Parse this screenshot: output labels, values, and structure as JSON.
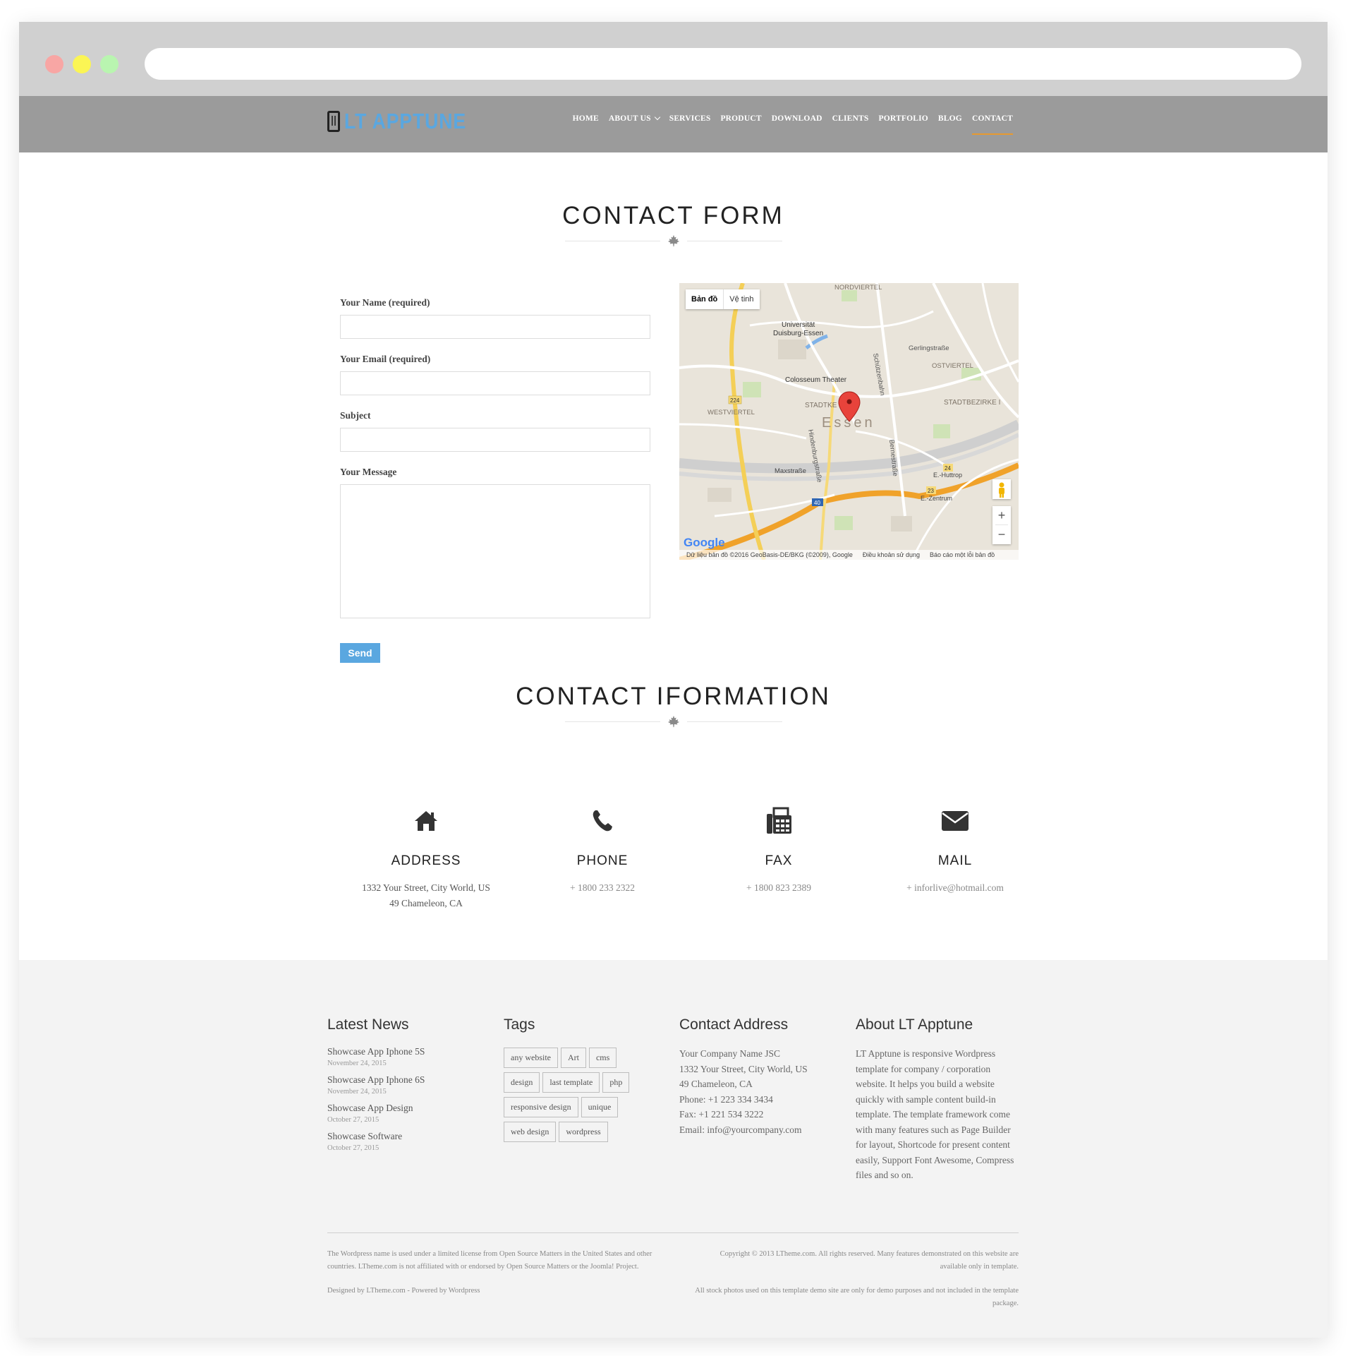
{
  "browser": {
    "url": ""
  },
  "brand": {
    "name": "LT APPTUNE"
  },
  "nav": {
    "items": [
      {
        "label": "HOME"
      },
      {
        "label": "ABOUT US"
      },
      {
        "label": "SERVICES"
      },
      {
        "label": "PRODUCT"
      },
      {
        "label": "DOWNLOAD"
      },
      {
        "label": "CLIENTS"
      },
      {
        "label": "PORTFOLIO"
      },
      {
        "label": "BLOG"
      },
      {
        "label": "CONTACT"
      }
    ],
    "active": "CONTACT"
  },
  "contact_form": {
    "title": "CONTACT FORM",
    "name_label": "Your Name (required)",
    "name_value": "",
    "email_label": "Your Email (required)",
    "email_value": "",
    "subject_label": "Subject",
    "subject_value": "",
    "message_label": "Your Message",
    "message_value": "",
    "send_label": "Send"
  },
  "map": {
    "mode_map": "Bản đồ",
    "mode_satellite": "Vệ tinh",
    "city": "Essen",
    "labels": {
      "nordviertel": "NORDVIERTEL",
      "uni": "Universität",
      "uni2": "Duisburg-Essen",
      "colosseum": "Colosseum Theater",
      "gerling": "Gerlingstraße",
      "ostviertel": "OSTVIERTEL",
      "westviertel": "WESTVIERTEL",
      "stadtkern": "STADTKE",
      "stadtbezirke": "STADTBEZIRKE I",
      "max": "Maxstraße",
      "huttrop": "E.-Huttrop",
      "zentrum": "E.-Zentrum",
      "schuetzen": "Schützenbahn",
      "hindenburg": "Hindenburgstraße",
      "bernestr": "Bernestraße"
    },
    "road_numbers": [
      "224",
      "40",
      "24",
      "23"
    ],
    "zoom_in": "+",
    "zoom_out": "−",
    "google": "Google",
    "attribution": "Dữ liệu bản đồ ©2016 GeoBasis-DE/BKG (©2009), Google",
    "terms": "Điều khoản sử dụng",
    "report": "Báo cáo một lỗi bản đồ"
  },
  "contact_info": {
    "title": "CONTACT IFORMATION",
    "items": [
      {
        "icon": "home-icon",
        "heading": "ADDRESS",
        "line1": "1332 Your Street, City World, US",
        "line2": "49 Chameleon, CA"
      },
      {
        "icon": "phone-icon",
        "heading": "PHONE",
        "line1": "+ 1800 233 2322"
      },
      {
        "icon": "fax-icon",
        "heading": "FAX",
        "line1": "+ 1800 823 2389"
      },
      {
        "icon": "mail-icon",
        "heading": "MAIL",
        "line1": "+ inforlive@hotmail.com"
      }
    ]
  },
  "footer": {
    "news_heading": "Latest News",
    "news": [
      {
        "title": "Showcase App Iphone 5S",
        "date": "November 24, 2015"
      },
      {
        "title": "Showcase App Iphone 6S",
        "date": "November 24, 2015"
      },
      {
        "title": "Showcase App Design",
        "date": "October 27, 2015"
      },
      {
        "title": "Showcase Software",
        "date": "October 27, 2015"
      }
    ],
    "tags_heading": "Tags",
    "tags": [
      "any website",
      "Art",
      "cms",
      "design",
      "last template",
      "php",
      "responsive design",
      "unique",
      "web design",
      "wordpress"
    ],
    "address_heading": "Contact Address",
    "address_lines": [
      "Your Company Name JSC",
      "1332 Your Street, City World, US",
      "49 Chameleon, CA",
      "Phone: +1 223 334 3434",
      "Fax: +1 221 534 3222",
      "Email: info@yourcompany.com"
    ],
    "about_heading": "About LT Apptune",
    "about_text": "LT Apptune is responsive Wordpress template for company / corporation website. It helps you build a website quickly with sample content build-in template. The template framework come with many features such as Page Builder for layout, Shortcode for present content easily, Support Font Awesome, Compress files and so on.",
    "legal_left": "The Wordpress name is used under a limited license from Open Source Matters in the United States and other countries. LTheme.com is not affiliated with or endorsed by Open Source Matters or the Joomla! Project.",
    "credit": "Designed by LTheme.com - Powered by Wordpress",
    "copyright": "Copyright © 2013 LTheme.com. All rights reserved. Many features demonstrated on this website are available only in template.",
    "stock_note": "All stock photos used on this template demo site are only for demo purposes and not included in the template package."
  },
  "colors": {
    "accent": "#5aa7e0",
    "nav_bg": "#9b9b9b",
    "active_underline": "#e79a2f",
    "footer_bg": "#f3f3f3"
  }
}
